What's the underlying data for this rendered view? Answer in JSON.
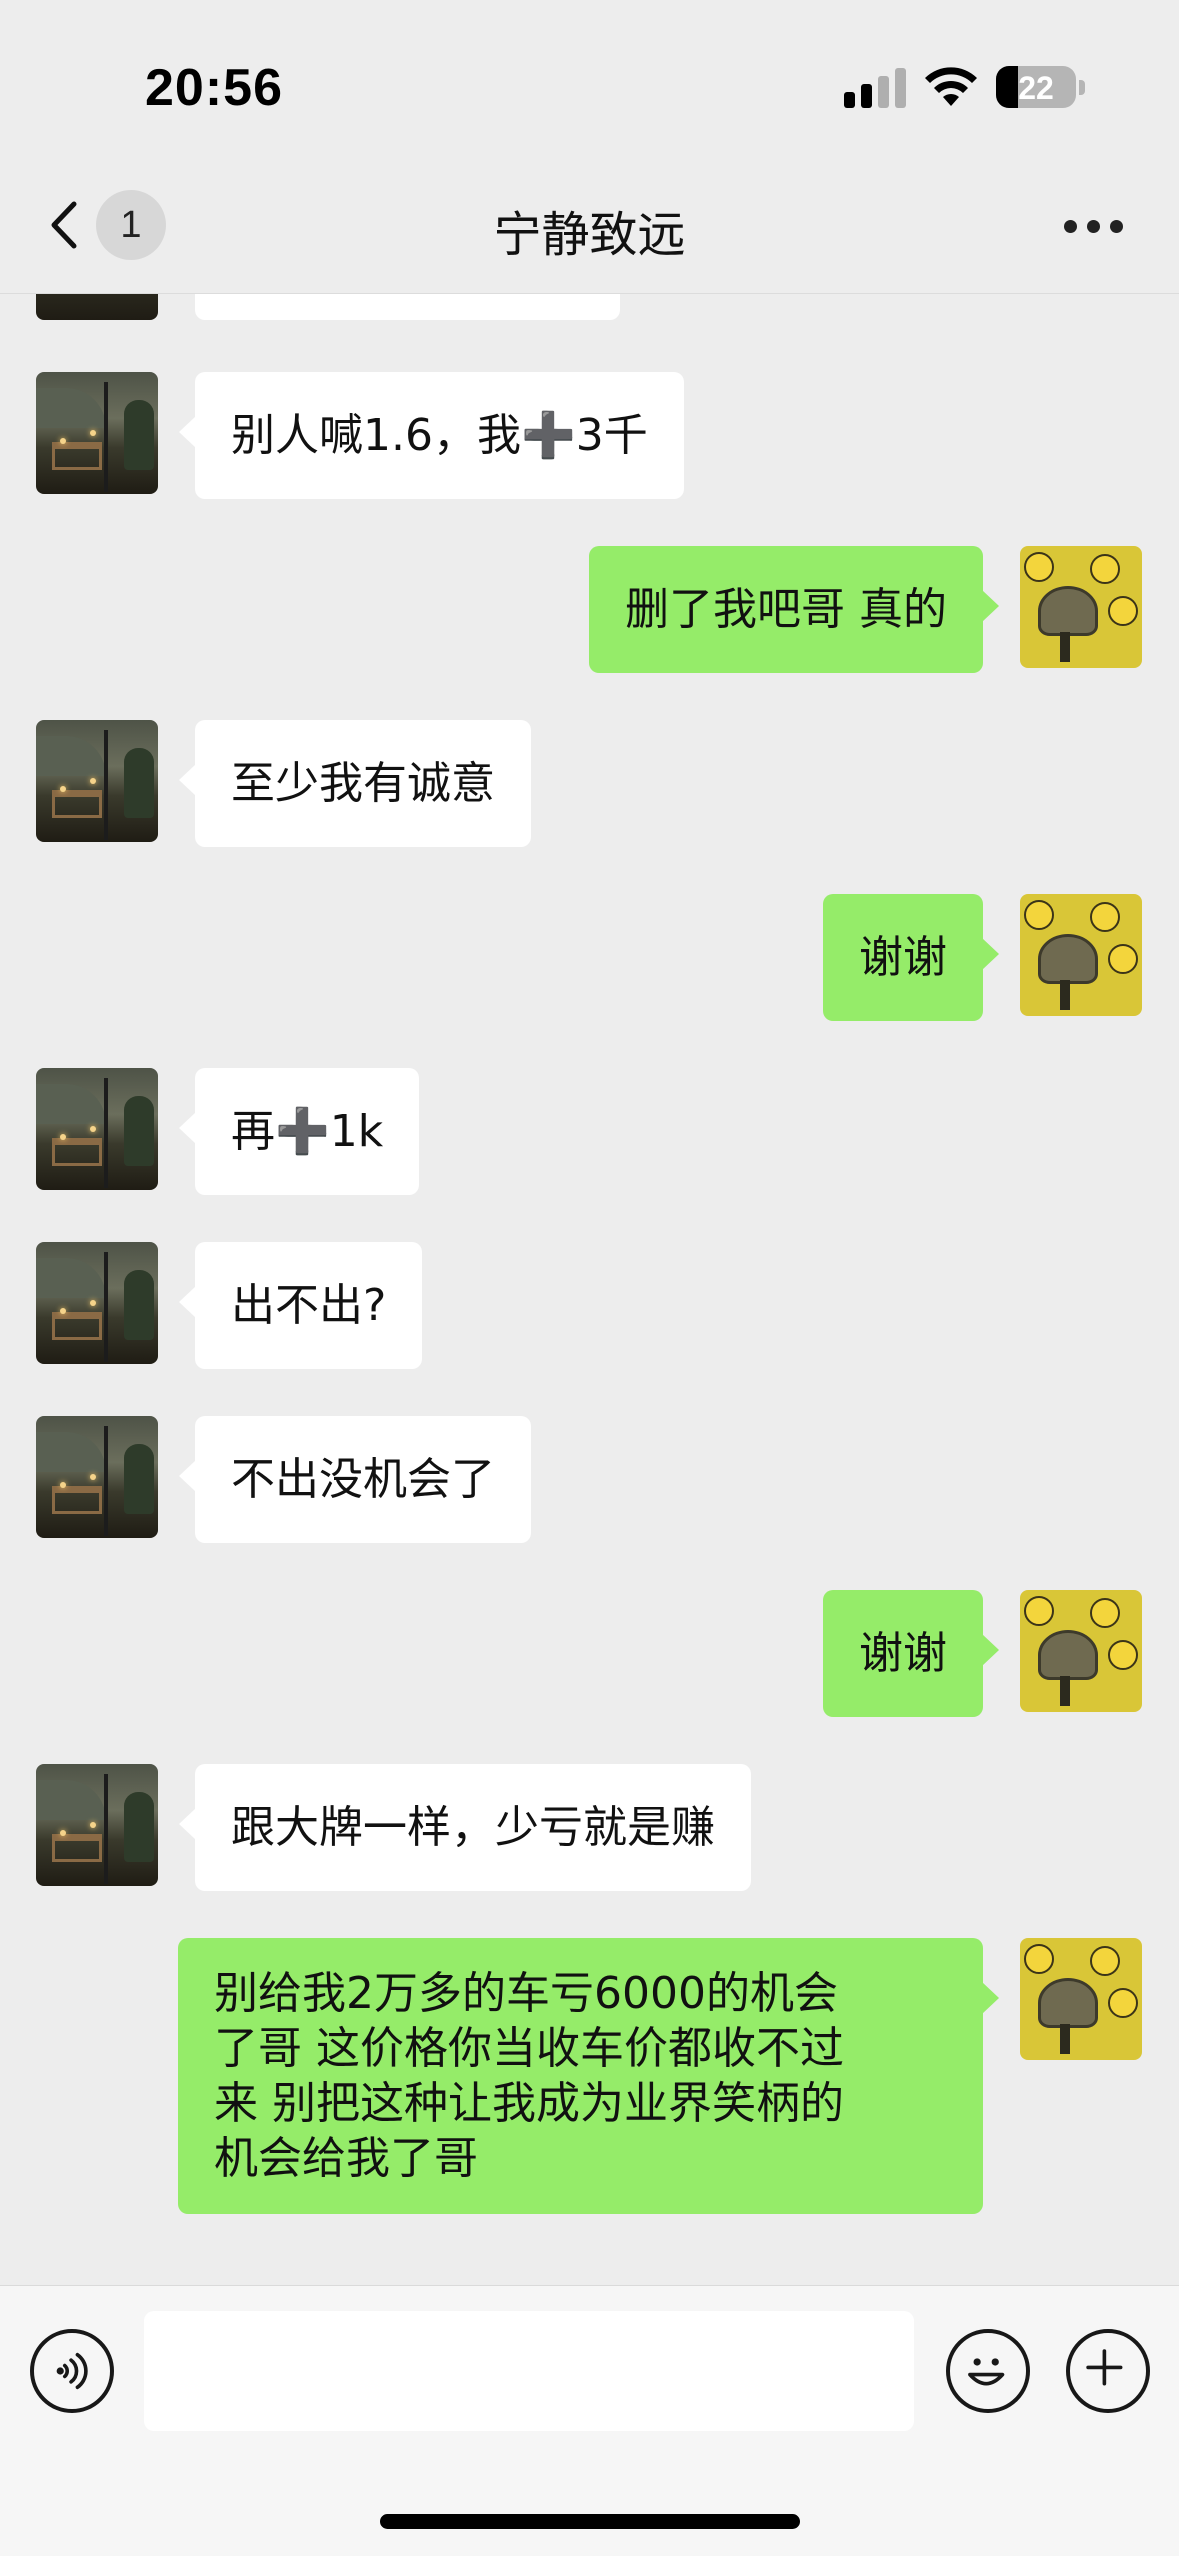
{
  "status_bar": {
    "time": "20:56",
    "battery": "22",
    "icons": [
      "cellular-signal-icon",
      "wifi-icon",
      "battery-icon"
    ]
  },
  "nav": {
    "back_icon": "chevron-left-icon",
    "unread_badge": "1",
    "title": "宁静致远",
    "more_icon": "more-dots-icon"
  },
  "messages": [
    {
      "sender": "other",
      "text": "别人喊1.6，我➕3千"
    },
    {
      "sender": "me",
      "text": "删了我吧哥 真的"
    },
    {
      "sender": "other",
      "text": "至少我有诚意"
    },
    {
      "sender": "me",
      "text": "谢谢"
    },
    {
      "sender": "other",
      "text": "再➕1k"
    },
    {
      "sender": "other",
      "text": "出不出?"
    },
    {
      "sender": "other",
      "text": "不出没机会了"
    },
    {
      "sender": "me",
      "text": "谢谢"
    },
    {
      "sender": "other",
      "text": "跟大牌一样，少亏就是赚"
    },
    {
      "sender": "me",
      "text": "别给我2万多的车亏6000的机会\n了哥 这价格你当收车价都收不过\n来 别把这种让我成为业界笑柄的\n机会给我了哥"
    }
  ],
  "input_bar": {
    "voice_icon": "voice-icon",
    "input_value": "",
    "emoji_icon": "emoji-icon",
    "plus_icon": "plus-icon"
  },
  "colors": {
    "background": "#EDEDED",
    "my_bubble": "#95EC69",
    "other_bubble": "#FFFFFF"
  }
}
